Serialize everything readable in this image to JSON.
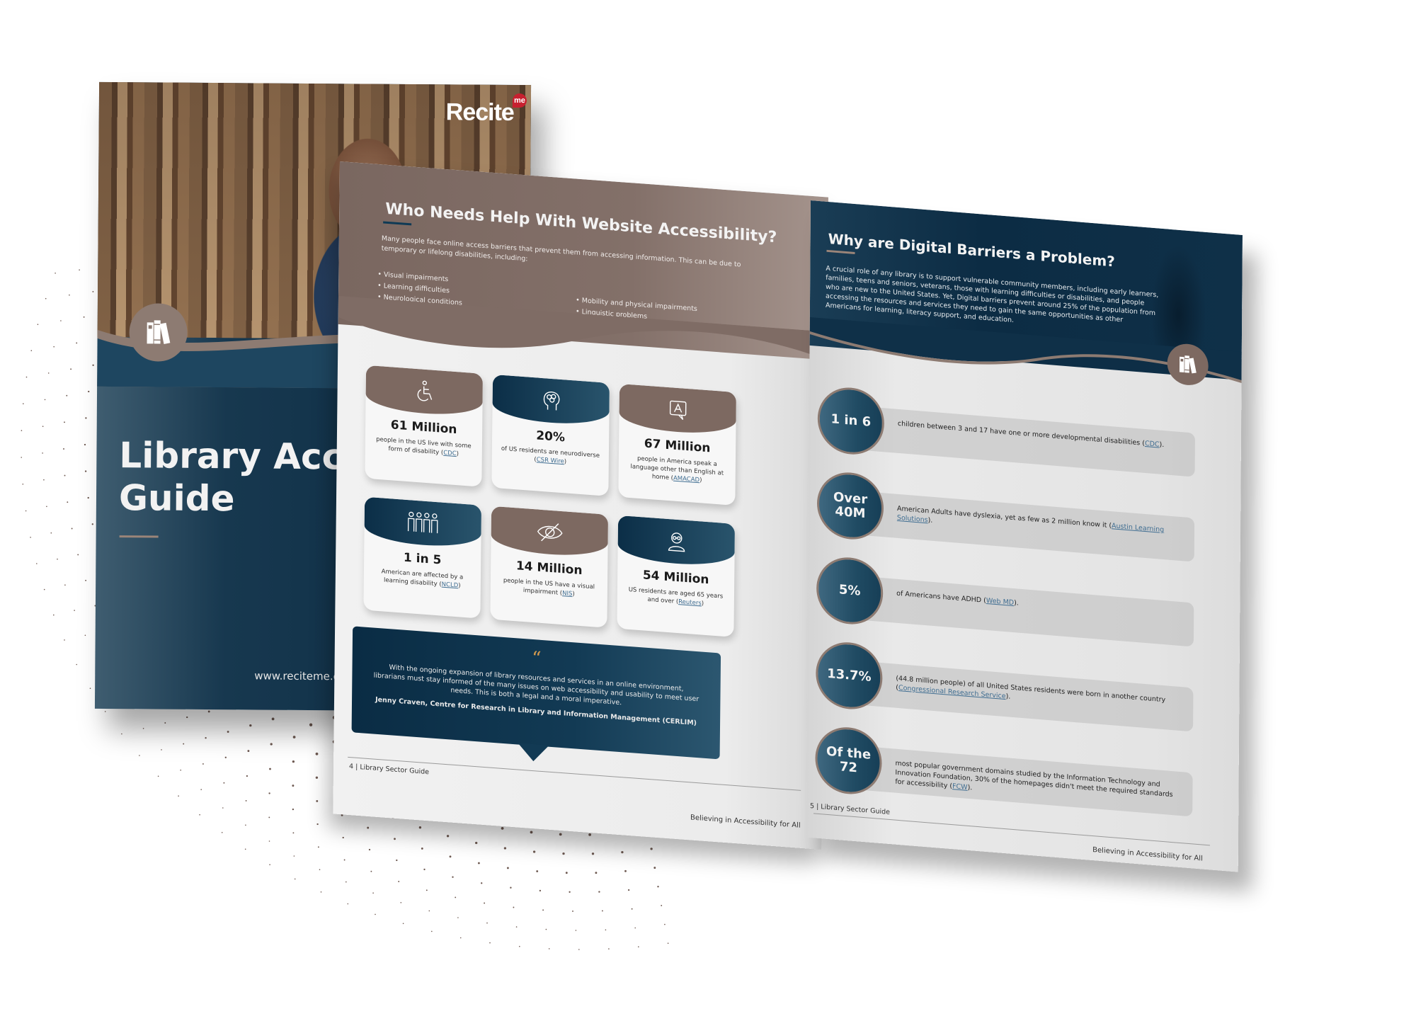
{
  "cover": {
    "brand": "Recite",
    "brand_badge": "me",
    "title": "Library Acces\nGuide",
    "url": "www.reciteme.com",
    "badge_icon": "books-icon"
  },
  "left_page": {
    "title": "Who Needs Help With Website Accessibility?",
    "intro": "Many people face online access barriers that prevent them from accessing information. This can be due to temporary or lifelong disabilities, including:",
    "bullets_col1": [
      "Visual impairments",
      "Learning difficulties",
      "Neurological conditions"
    ],
    "bullets_col2": [
      "Mobility and physical impairments",
      "Linguistic problems"
    ],
    "stats": [
      {
        "icon": "wheelchair-icon",
        "style": "brown",
        "value": "61 Million",
        "desc": "people in the US live with some form of disability (",
        "source": "CDC",
        "suffix": ")"
      },
      {
        "icon": "brain-head-icon",
        "style": "navy",
        "value": "20%",
        "desc": "of US residents are neurodiverse (",
        "source": "CSR Wire",
        "suffix": ")"
      },
      {
        "icon": "language-bubble-icon",
        "style": "brown",
        "value": "67 Million",
        "desc": "people in America speak a language other than English at home (",
        "source": "AMACAD",
        "suffix": ")"
      },
      {
        "icon": "group-people-icon",
        "style": "navy",
        "value": "1 in 5",
        "desc": "American are affected by a learning disability (",
        "source": "NCLD",
        "suffix": ")"
      },
      {
        "icon": "eye-slash-icon",
        "style": "brown",
        "value": "14 Million",
        "desc": "people in the US have a visual impairment (",
        "source": "NIS",
        "suffix": ")"
      },
      {
        "icon": "elderly-person-icon",
        "style": "navy",
        "value": "54 Million",
        "desc": "US residents are aged 65 years and over (",
        "source": "Reuters",
        "suffix": ")"
      }
    ],
    "quote": {
      "mark": "“",
      "text": "With the ongoing expansion of library resources and services in an online environment, librarians must stay informed of the many issues on web accessibility and usability to meet user needs. This is both a legal and a moral imperative.",
      "author": "Jenny Craven, Centre for Research in Library and Information Management (CERLIM)"
    },
    "footer_left": "4  | Library Sector Guide",
    "footer_right": "Believing in Accessibility for All"
  },
  "right_page": {
    "title": "Why are Digital Barriers a Problem?",
    "intro": "A crucial role of any library is to support vulnerable community members, including early learners, families, teens and seniors, veterans, those with learning difficulties or disabilities, and people who are new to the United States. Yet, Digital barriers prevent around 25% of the population from accessing the resources and services they need to gain the same opportunities as other Americans for learning, literacy support, and education.",
    "badge_icon": "books-icon",
    "facts": [
      {
        "value": "1 in 6",
        "text": "children between 3 and 17 have one or more developmental disabilities (",
        "source": "CDC",
        "suffix": ")."
      },
      {
        "value": "Over\n40M",
        "text": "American Adults have dyslexia, yet as few as 2 million know it (",
        "source": "Austin Learning Solutions",
        "suffix": ")."
      },
      {
        "value": "5%",
        "text": "of Americans have ADHD (",
        "source": "Web MD",
        "suffix": ")."
      },
      {
        "value": "13.7%",
        "text": "(44.8 million people) of all United States residents were born in another country (",
        "source": "Congressional Research Service",
        "suffix": ")."
      },
      {
        "value": "Of the\n72",
        "text": "most popular government domains studied by the Information Technology and Innovation Foundation, 30% of the homepages didn't meet the required standards for accessibility (",
        "source": "FCW",
        "suffix": ")."
      }
    ],
    "footer_left": "5  | Library Sector Guide",
    "footer_right": "Believing in Accessibility for All"
  },
  "colors": {
    "navy": "#0c2c44",
    "brown": "#7d6961",
    "accent_orange": "#d89d4e",
    "link_blue": "#3f6d91",
    "brand_red": "#c7202f"
  }
}
